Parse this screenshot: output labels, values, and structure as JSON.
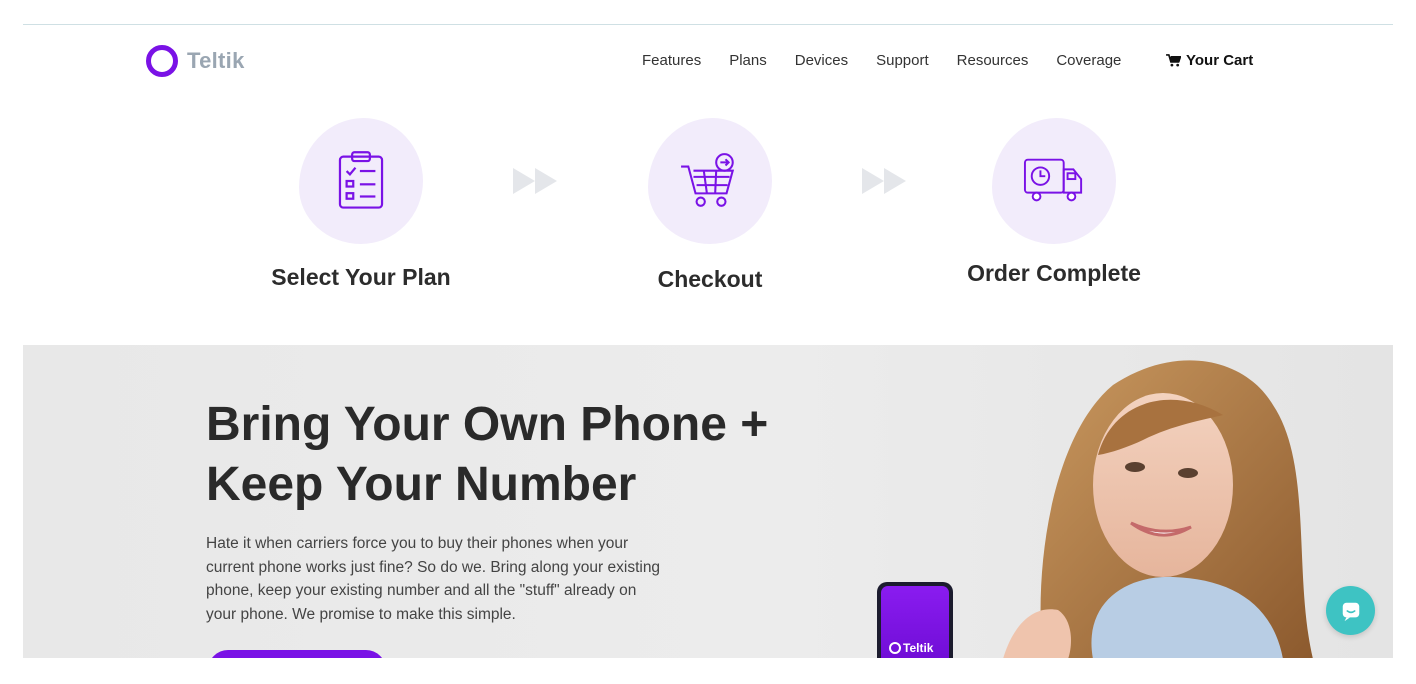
{
  "brand": {
    "name": "Teltik",
    "color": "#7a12e6"
  },
  "nav": {
    "items": [
      "Features",
      "Plans",
      "Devices",
      "Support",
      "Resources",
      "Coverage"
    ],
    "cart_label": "Your Cart",
    "cart_icon": "cart-icon"
  },
  "steps": [
    {
      "label": "Select Your Plan",
      "icon": "clipboard-checklist-icon"
    },
    {
      "label": "Checkout",
      "icon": "shopping-cart-icon"
    },
    {
      "label": "Order Complete",
      "icon": "delivery-truck-icon"
    }
  ],
  "hero": {
    "title_line1": "Bring Your Own Phone +",
    "title_line2": "Keep Your Number",
    "body": "Hate it when carriers force you to buy their phones when your current phone works just fine? So do we. Bring along your existing phone, keep your existing number and all the \"stuff\" already on your phone. We promise to make this simple.",
    "phone_brand": "Teltik"
  },
  "chat": {
    "icon": "chat-icon",
    "color": "#3ec3c3"
  }
}
